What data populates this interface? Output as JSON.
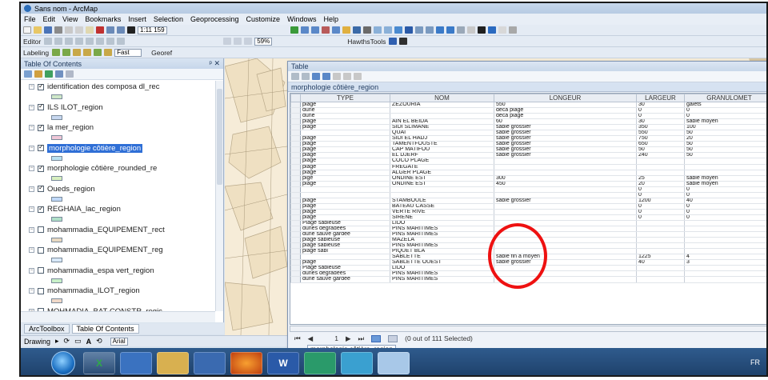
{
  "window": {
    "title": "Sans nom - ArcMap"
  },
  "menu": [
    "File",
    "Edit",
    "View",
    "Bookmarks",
    "Insert",
    "Selection",
    "Geoprocessing",
    "Customize",
    "Windows",
    "Help"
  ],
  "toolbar": {
    "scale": "1:11 159",
    "editor_label": "Editor",
    "zoom_pct": "59%",
    "hawths_label": "HawthsTools",
    "labeling_label": "Labeling",
    "fast_label": "Fast",
    "georef_label": "Georef"
  },
  "toc": {
    "title": "Table Of Contents",
    "layers": [
      {
        "name": "identification des composa dl_rec",
        "checked": true,
        "selected": false,
        "swatch": "#cfe8c8"
      },
      {
        "name": "ILS ILOT_region",
        "checked": true,
        "selected": false,
        "swatch": "#c8d8f0"
      },
      {
        "name": "la mer_region",
        "checked": true,
        "selected": false,
        "swatch": "#f0c8d8"
      },
      {
        "name": "morphologie côtière_region",
        "checked": true,
        "selected": true,
        "swatch": "#b8e0f0"
      },
      {
        "name": "morphologie côtière_rounded_re",
        "checked": true,
        "selected": false,
        "swatch": "#d8f0c0"
      },
      {
        "name": "Oueds_region",
        "checked": true,
        "selected": false,
        "swatch": "#c0d8f8"
      },
      {
        "name": "REGHAIA_lac_region",
        "checked": true,
        "selected": false,
        "swatch": "#b0e0c8"
      },
      {
        "name": "mohammadia_EQUIPEMENT_rect",
        "checked": false,
        "selected": false,
        "swatch": "#e8d8c0"
      },
      {
        "name": "mohammadia_EQUIPEMENT_reg",
        "checked": false,
        "selected": false,
        "swatch": "#d8e8f8"
      },
      {
        "name": "mohammadia_espa vert_region",
        "checked": false,
        "selected": false,
        "swatch": "#c8f0c8"
      },
      {
        "name": "mohammadia_ILOT_region",
        "checked": false,
        "selected": false,
        "swatch": "#f0d8c8"
      },
      {
        "name": "MOHMADIA_BAT-CONSTR_regic",
        "checked": false,
        "selected": false,
        "swatch": "#d8d8f0"
      },
      {
        "name": "MOHMADIA_BAT-DUR 01_rectan",
        "checked": false,
        "selected": false,
        "swatch": "#f0e8c8"
      }
    ]
  },
  "bottom_tabs": {
    "arctoolbox": "ArcToolbox",
    "toc": "Table Of Contents"
  },
  "drawing": {
    "label": "Drawing",
    "font": "Arial"
  },
  "table": {
    "window_title": "Table",
    "layer_tab": "morphologie côtière_region",
    "columns": [
      "TYPE",
      "NOM",
      "LONGEUR",
      "LARGEUR",
      "GRANULOMET"
    ],
    "rows": [
      [
        "plage",
        "ZEZOURIA",
        "550",
        "30",
        "galets"
      ],
      [
        "dune",
        "",
        "deca plage",
        "0",
        "0"
      ],
      [
        "dune",
        "",
        "deca plage",
        "0",
        "0"
      ],
      [
        "plage",
        "AIN EL BEIDA",
        "60",
        "30",
        "sable moyen"
      ],
      [
        "plage",
        "SIDI SLIMANE",
        "sable grossier",
        "350",
        "100"
      ],
      [
        "",
        "QUAI",
        "sable grossier",
        "550",
        "50"
      ],
      [
        "plage",
        "SIDI EL HADJ",
        "sable grossier",
        "750",
        "20"
      ],
      [
        "plage",
        "TAMENTFOUSTE",
        "sable grossier",
        "650",
        "50"
      ],
      [
        "plage",
        "CAP MATIFOU",
        "sable grossier",
        "50",
        "50"
      ],
      [
        "plage",
        "EL DJERF",
        "sable grossier",
        "240",
        "50"
      ],
      [
        "plage",
        "COCO PLAGE",
        "",
        "",
        ""
      ],
      [
        "plage",
        "FRÉGATE",
        "",
        "",
        ""
      ],
      [
        "plage",
        "ALGER PLAGE",
        "",
        "",
        ""
      ],
      [
        "plge",
        "ONDINE EST",
        "300",
        "25",
        "sable moyen"
      ],
      [
        "plage",
        "ONDINE EST",
        "450",
        "20",
        "sable moyen"
      ],
      [
        "",
        "",
        "",
        "0",
        "0"
      ],
      [
        "",
        "",
        "",
        "0",
        "0"
      ],
      [
        "plage",
        "STAMBOULE",
        "sable grossier",
        "1200",
        "40"
      ],
      [
        "plage",
        "BATEAU CASSÉ",
        "",
        "0",
        "0"
      ],
      [
        "plage",
        "VERTE RIVE",
        "",
        "0",
        "0"
      ],
      [
        "plage",
        "SIRÈNE",
        "",
        "0",
        "0"
      ],
      [
        "Plage sableuse",
        "LIDO",
        "",
        "",
        ""
      ],
      [
        "dunes dégradées",
        "PINS MARITIMES",
        "",
        "",
        ""
      ],
      [
        "dune sauve gardée",
        "PINS MARITIMES",
        "",
        "",
        ""
      ],
      [
        "plage sableuse",
        "MAZÉLA",
        "",
        "",
        ""
      ],
      [
        "plage sableuse",
        "PINS MARITIMES",
        "",
        "",
        ""
      ],
      [
        "plage sabl",
        "PIQUET BLA",
        "",
        "",
        ""
      ],
      [
        "",
        "SABLETTE",
        "sable fin à moyen",
        "1225",
        "4"
      ],
      [
        "plage",
        "SABLETTE OUEST",
        "sable grossier",
        "40",
        "3"
      ],
      [
        "Plage sableuse",
        "LIDO",
        "",
        "",
        ""
      ],
      [
        "dunes dégradées",
        "PINS MARITIMES",
        "",
        "",
        ""
      ],
      [
        "dune sauve gardée",
        "PINS MARITIMES",
        "",
        "",
        ""
      ]
    ],
    "nav": {
      "first": "⏮",
      "prev": "◀",
      "record": "1",
      "next": "▶",
      "last": "⏭",
      "selection_status": "(0 out of 111 Selected)"
    },
    "bottom_tab": "morphologie côtière_region"
  },
  "taskbar": {
    "apps": [
      "X",
      "",
      "",
      "",
      "",
      "W",
      "",
      "",
      ""
    ],
    "lang": "FR"
  }
}
